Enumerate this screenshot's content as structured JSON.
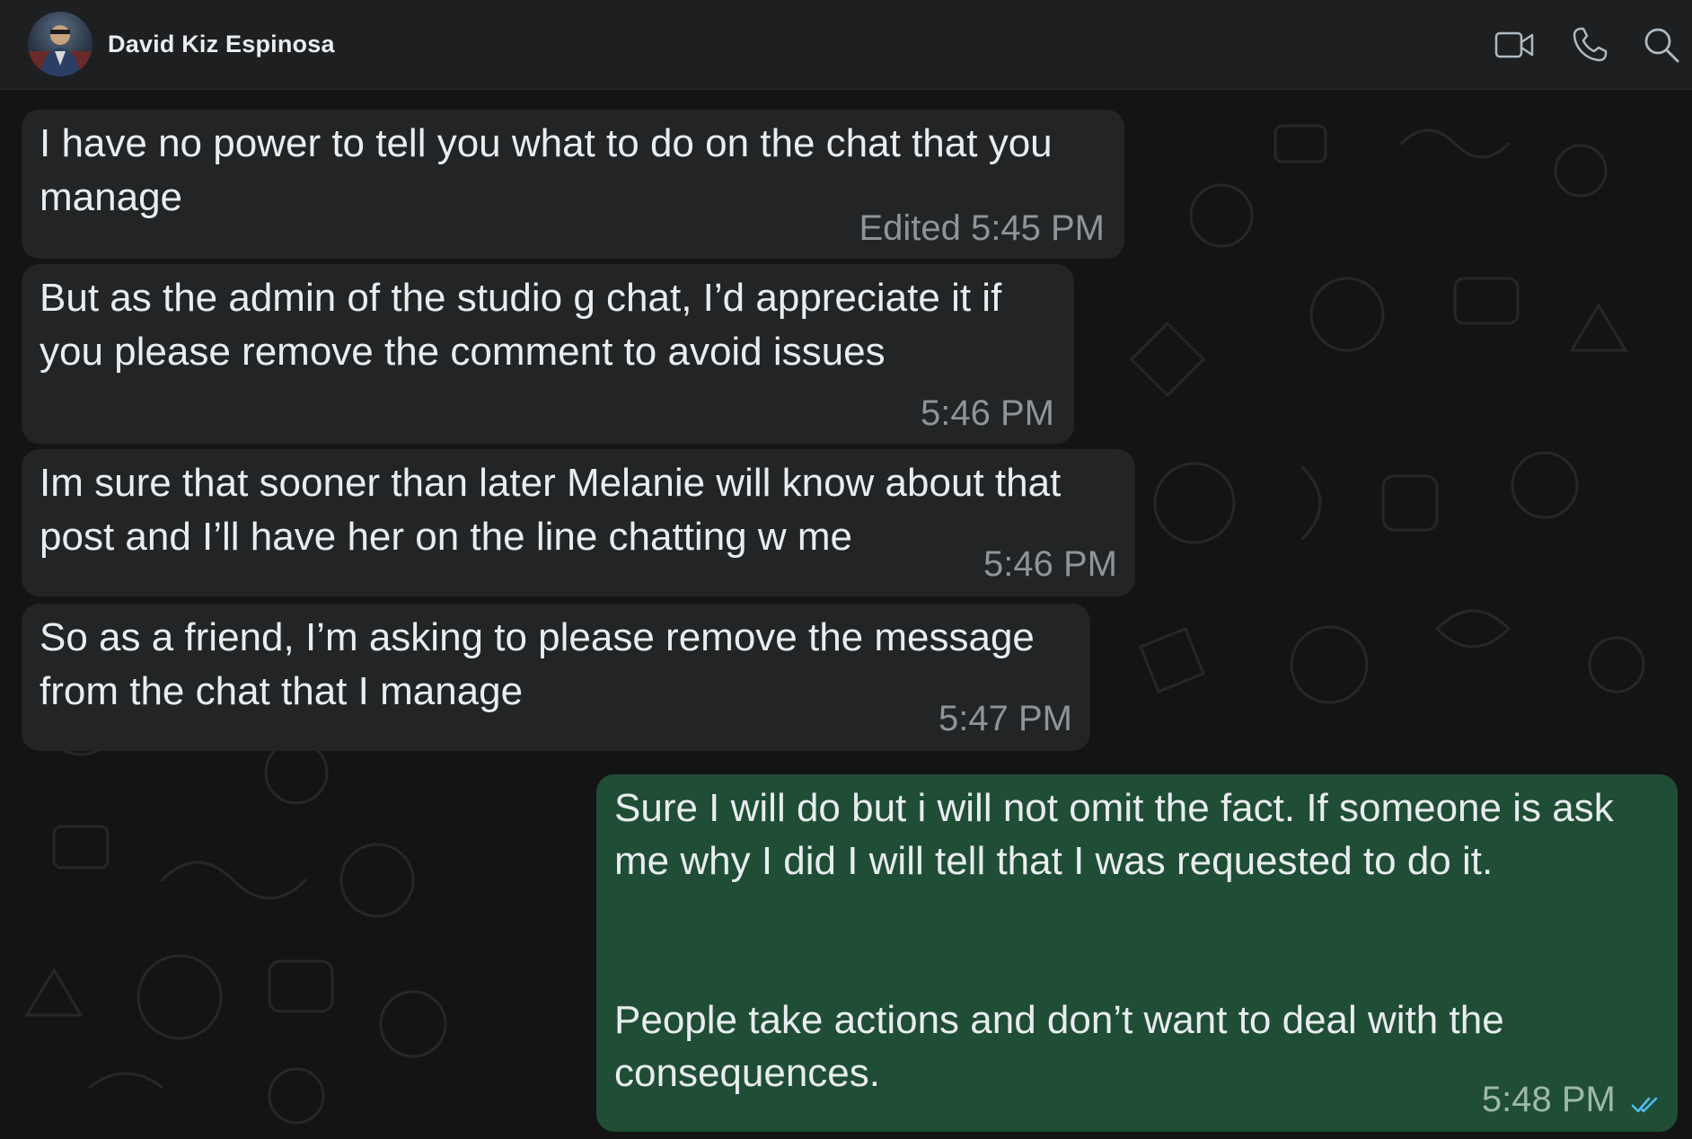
{
  "header": {
    "contact_name": "David Kiz Espinosa",
    "avatar_icon": "contact-avatar",
    "icons": {
      "video": "video-camera-icon",
      "call": "phone-icon",
      "search": "search-icon"
    }
  },
  "messages": [
    {
      "direction": "incoming",
      "text": "I have no power to tell you what to do on the chat that you\nmanage",
      "edited_label": "Edited",
      "time": "5:45 PM"
    },
    {
      "direction": "incoming",
      "text": "But as the admin of the studio g chat, I’d appreciate it if\nyou please remove the comment to avoid issues",
      "time": "5:46 PM"
    },
    {
      "direction": "incoming",
      "text": "Im sure that sooner than later Melanie will know about that\npost and I’ll have her on the line chatting w me",
      "time": "5:46 PM"
    },
    {
      "direction": "incoming",
      "text": "So as a friend, I’m asking to please remove the message\nfrom the chat that I manage",
      "time": "5:47 PM"
    },
    {
      "direction": "outgoing",
      "text": "Sure I will do but i will not omit the fact. If someone is ask\nme why I did I will tell that I was requested to do it.\n\n\nPeople take actions and don’t want to deal with the\nconsequences.",
      "time": "5:48 PM",
      "status": "read"
    }
  ],
  "colors": {
    "header_bg": "#1e1f20",
    "incoming_bubble": "#222425",
    "outgoing_bubble": "#1f4d36",
    "read_ticks": "#53bdeb",
    "text": "#e9edef"
  }
}
